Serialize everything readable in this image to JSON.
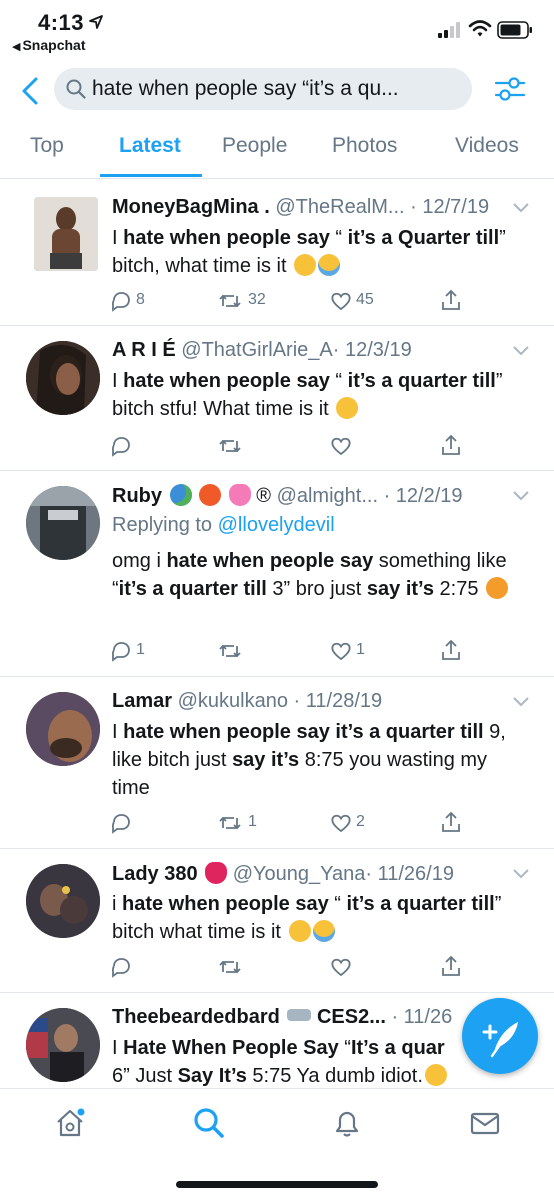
{
  "status_bar": {
    "time": "4:13",
    "back_app": "Snapchat",
    "icons": [
      "location-arrow-icon",
      "signal-icon",
      "wifi-icon",
      "battery-icon"
    ]
  },
  "search": {
    "query": "hate when people say “it’s a qu...",
    "icons": [
      "back-chevron-icon",
      "search-icon",
      "filter-icon"
    ]
  },
  "tabs": [
    {
      "label": "Top",
      "active": false
    },
    {
      "label": "Latest",
      "active": true
    },
    {
      "label": "People",
      "active": false
    },
    {
      "label": "Photos",
      "active": false
    },
    {
      "label": "Videos",
      "active": false
    }
  ],
  "colors": {
    "accent": "#1da1f2",
    "text": "#14171a",
    "secondary": "#657786",
    "divider": "#e1e8ed",
    "search_bg": "#e6ecf0"
  },
  "tweets": [
    {
      "name": "MoneyBagMina .",
      "handle": "@TheRealM...",
      "date": "· 12/7/19",
      "text_parts": [
        "I ",
        "hate when people say",
        " “ ",
        "it’s a Quarter till",
        "” bitch,  what time is it "
      ],
      "emojis": [
        "unamused-face",
        "loudly-crying-face"
      ],
      "replies": "8",
      "retweets": "32",
      "likes": "45"
    },
    {
      "name": "A R I É",
      "handle": "@ThatGirlArie_A",
      "date": "· 12/3/19",
      "text_parts": [
        "I ",
        "hate when people say",
        " “ ",
        "it’s a quarter till",
        "” bitch stfu! What time is it "
      ],
      "emojis": [
        "unamused-face"
      ],
      "replies": "",
      "retweets": "",
      "likes": ""
    },
    {
      "name": "Ruby",
      "name_emojis": [
        "globe-emoji",
        "ping-pong-emoji",
        "sparkling-heart-emoji",
        "registered-sign"
      ],
      "registered": "®",
      "handle": "@almight...",
      "date": "· 12/2/19",
      "replying_prefix": "Replying to",
      "replying_to": "@llovelydevil",
      "text_parts": [
        "omg i ",
        "hate when people say",
        " something like “",
        "it’s a quarter till",
        " 3” bro just ",
        "say it’s",
        " 2:75 "
      ],
      "emojis": [
        "angry-face"
      ],
      "replies": "1",
      "retweets": "",
      "likes": "1"
    },
    {
      "name": "Lamar",
      "handle": "@kukulkano",
      "date": "· 11/28/19",
      "text_parts": [
        "I ",
        "hate when people say it’s a quarter till",
        " 9, like bitch just ",
        "say it’s",
        " 8:75 you wasting my time"
      ],
      "emojis": [],
      "replies": "",
      "retweets": "1",
      "likes": "2"
    },
    {
      "name": "Lady 380",
      "name_emojis": [
        "red-heart-emoji"
      ],
      "handle": "@Young_Yana",
      "date": "· 11/26/19",
      "text_parts": [
        "i ",
        "hate when people say",
        " “ ",
        "it’s a quarter till",
        "” bitch what time is it "
      ],
      "emojis": [
        "unamused-face",
        "loudly-crying-face"
      ],
      "replies": "",
      "retweets": "",
      "likes": ""
    },
    {
      "name": "Theebeardedbard",
      "name_emojis": [
        "airplane-emoji"
      ],
      "name_suffix": "CES2...",
      "handle": "",
      "date": "· 11/26",
      "text_parts": [
        "I ",
        "Hate When People Say",
        " “",
        "It’s a quar",
        "",
        "",
        ""
      ],
      "text_line2": [
        "6” Just ",
        "Say It’s",
        " 5:75 Ya dumb idiot."
      ],
      "emojis": [
        "rolling-eyes-face"
      ],
      "replies": "",
      "retweets": "",
      "likes": ""
    }
  ],
  "bottom_nav": [
    "home-icon",
    "search-icon",
    "notifications-icon",
    "messages-icon"
  ],
  "compose": {
    "icon": "compose-tweet-icon"
  }
}
